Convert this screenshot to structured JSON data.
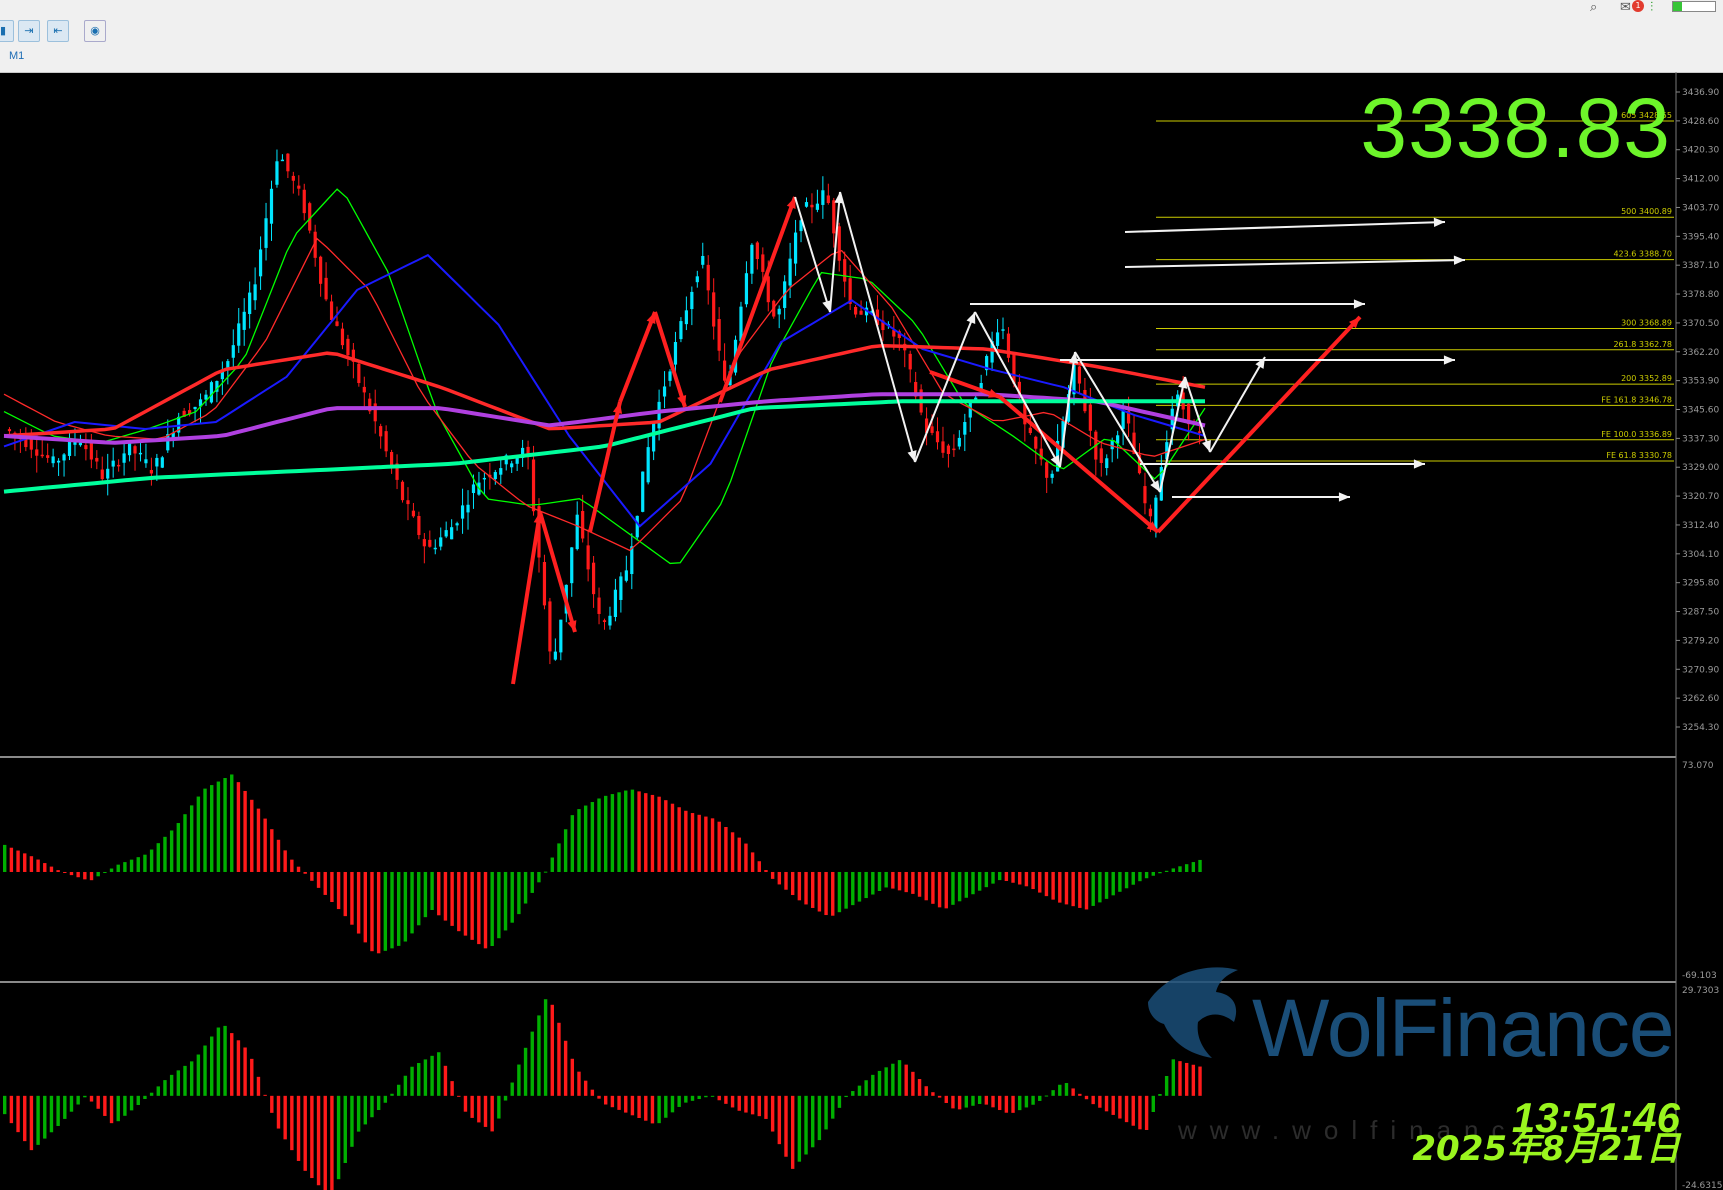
{
  "toolbar": {
    "timeframe": "M1",
    "buttons": [
      "auto-scroll-icon",
      "chart-shift-icon",
      "screenshot-icon"
    ],
    "notification_count": "1",
    "icons": [
      "search-icon",
      "notification-icon",
      "signal-icon",
      "battery-icon"
    ]
  },
  "big_price": "3338.83",
  "watermark": {
    "brand": "WolFinance",
    "url": "www.wolfinance"
  },
  "clock": {
    "time": "13:51:46",
    "date": "2025年8月21日"
  },
  "colors": {
    "bull": "#00e5ff",
    "bear": "#ff1a1a",
    "ma_green": "#00ff00",
    "ma_red": "#ff2a2a",
    "ma_blue": "#1a1aff",
    "ma_purple": "#b040e0",
    "ma_teal": "#00ff9c",
    "fib": "#cccc00",
    "hist_up": "#00b000",
    "hist_down": "#ff1a1a",
    "price": "#6df52a"
  },
  "chart_data": [
    {
      "type": "candlestick",
      "panel": "price",
      "timeframe": "M1",
      "y_ticks": [
        "3436.90",
        "3428.60",
        "3420.30",
        "3412.00",
        "3403.70",
        "3395.40",
        "3387.10",
        "3378.80",
        "3370.50",
        "3362.20",
        "3353.90",
        "3345.60",
        "3337.30",
        "3329.00",
        "3320.70",
        "3312.40",
        "3304.10",
        "3295.80",
        "3287.50",
        "3279.20",
        "3270.90",
        "3262.60",
        "3254.30"
      ],
      "ylim": [
        3249,
        3440
      ],
      "close_path": [
        3340,
        3336,
        3330,
        3338,
        3326,
        3335,
        3328,
        3344,
        3348,
        3360,
        3380,
        3420,
        3405,
        3375,
        3358,
        3340,
        3320,
        3305,
        3312,
        3325,
        3330,
        3334,
        3270,
        3315,
        3282,
        3300,
        3340,
        3365,
        3390,
        3350,
        3395,
        3370,
        3402,
        3408,
        3375,
        3372,
        3365,
        3340,
        3332,
        3350,
        3372,
        3340,
        3325,
        3358,
        3328,
        3345,
        3312,
        3350,
        3338
      ],
      "fib_levels": [
        {
          "label": "605",
          "value": "3428.55"
        },
        {
          "label": "500",
          "value": "3400.89"
        },
        {
          "label": "423.6",
          "value": "3388.70"
        },
        {
          "label": "300",
          "value": "3368.89"
        },
        {
          "label": "261.8",
          "value": "3362.78"
        },
        {
          "label": "200",
          "value": "3352.89"
        },
        {
          "label": "FE 161.8",
          "value": "3346.78"
        },
        {
          "label": "FE 100.0",
          "value": "3336.89"
        },
        {
          "label": "FE 61.8",
          "value": "3330.78"
        }
      ],
      "moving_averages": [
        {
          "color": "green",
          "path": [
            3345,
            3338,
            3336,
            3340,
            3345,
            3360,
            3395,
            3410,
            3385,
            3345,
            3320,
            3318,
            3320,
            3310,
            3300,
            3320,
            3360,
            3385,
            3383,
            3370,
            3347,
            3338,
            3328,
            3338,
            3325,
            3346
          ]
        },
        {
          "color": "red",
          "path": [
            3350,
            3342,
            3338,
            3337,
            3345,
            3365,
            3395,
            3380,
            3350,
            3330,
            3318,
            3312,
            3305,
            3320,
            3360,
            3380,
            3392,
            3375,
            3350,
            3342,
            3345,
            3336,
            3332,
            3337
          ]
        },
        {
          "color": "blue",
          "path": [
            3335,
            3342,
            3340,
            3342,
            3355,
            3380,
            3390,
            3370,
            3338,
            3312,
            3330,
            3365,
            3377,
            3363,
            3357,
            3352,
            3344,
            3338
          ]
        },
        {
          "color": "thick-red",
          "path": [
            3338,
            3340,
            3357,
            3362,
            3352,
            3340,
            3342,
            3357,
            3364,
            3363,
            3358,
            3352
          ]
        },
        {
          "color": "purple",
          "path": [
            3338,
            3336,
            3338,
            3346,
            3346,
            3341,
            3345,
            3348,
            3350,
            3350,
            3348,
            3341
          ]
        },
        {
          "color": "teal",
          "path": [
            3322,
            3326,
            3328,
            3330,
            3335,
            3346,
            3348,
            3348,
            3348
          ]
        }
      ],
      "annotations": {
        "red_arrows": "trend wave arrows",
        "white_arrows": "projection arrows"
      }
    },
    {
      "type": "bar",
      "panel": "oscillator-1",
      "y_ticks": [
        "73.070",
        "-69.103"
      ],
      "ylim": [
        -69.103,
        73.07
      ],
      "values_path": [
        18,
        10,
        0,
        -6,
        5,
        12,
        30,
        55,
        65,
        40,
        10,
        -10,
        -30,
        -55,
        -48,
        -25,
        -40,
        -52,
        -30,
        0,
        40,
        50,
        55,
        50,
        40,
        35,
        20,
        -5,
        -20,
        -30,
        -20,
        -10,
        -15,
        -25,
        -15,
        -5,
        -10,
        -20,
        -25,
        -15,
        -5,
        2,
        8
      ]
    },
    {
      "type": "bar",
      "panel": "oscillator-2",
      "y_ticks": [
        "29.7303",
        "-24.6315"
      ],
      "ylim": [
        -24.6315,
        29.7303
      ],
      "values_path": [
        -5,
        -15,
        -8,
        0,
        -8,
        -2,
        5,
        10,
        20,
        12,
        -8,
        -20,
        -28,
        -10,
        -2,
        8,
        12,
        -5,
        -10,
        10,
        28,
        8,
        -2,
        -5,
        -8,
        -2,
        0,
        -4,
        -6,
        -20,
        -12,
        0,
        6,
        10,
        2,
        -4,
        -2,
        -5,
        -2,
        4,
        -2,
        -6,
        -10,
        10,
        8
      ]
    }
  ]
}
